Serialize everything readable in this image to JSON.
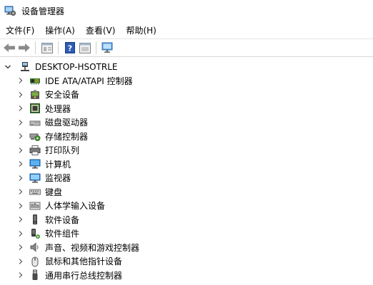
{
  "window": {
    "title": "设备管理器"
  },
  "menu": [
    {
      "label": "文件(F)"
    },
    {
      "label": "操作(A)"
    },
    {
      "label": "查看(V)"
    },
    {
      "label": "帮助(H)"
    }
  ],
  "toolbar": {
    "buttons": [
      "back-arrow-icon",
      "forward-arrow-icon",
      "properties-icon",
      "help-icon",
      "view-panel-icon",
      "monitor-scan-icon"
    ]
  },
  "tree": {
    "root": {
      "label": "DESKTOP-HSOTRLE",
      "icon": "computer-network-icon"
    },
    "items": [
      {
        "label": "IDE ATA/ATAPI 控制器",
        "icon": "ide-controller-icon"
      },
      {
        "label": "安全设备",
        "icon": "security-device-icon"
      },
      {
        "label": "处理器",
        "icon": "processor-icon"
      },
      {
        "label": "磁盘驱动器",
        "icon": "disk-drive-icon"
      },
      {
        "label": "存储控制器",
        "icon": "storage-controller-icon"
      },
      {
        "label": "打印队列",
        "icon": "printer-icon"
      },
      {
        "label": "计算机",
        "icon": "computer-icon"
      },
      {
        "label": "监视器",
        "icon": "monitor-icon"
      },
      {
        "label": "键盘",
        "icon": "keyboard-icon"
      },
      {
        "label": "人体学输入设备",
        "icon": "hid-icon"
      },
      {
        "label": "软件设备",
        "icon": "software-device-icon"
      },
      {
        "label": "软件组件",
        "icon": "software-component-icon"
      },
      {
        "label": "声音、视频和游戏控制器",
        "icon": "speaker-icon"
      },
      {
        "label": "鼠标和其他指针设备",
        "icon": "mouse-icon"
      },
      {
        "label": "通用串行总线控制器",
        "icon": "usb-icon"
      }
    ]
  }
}
